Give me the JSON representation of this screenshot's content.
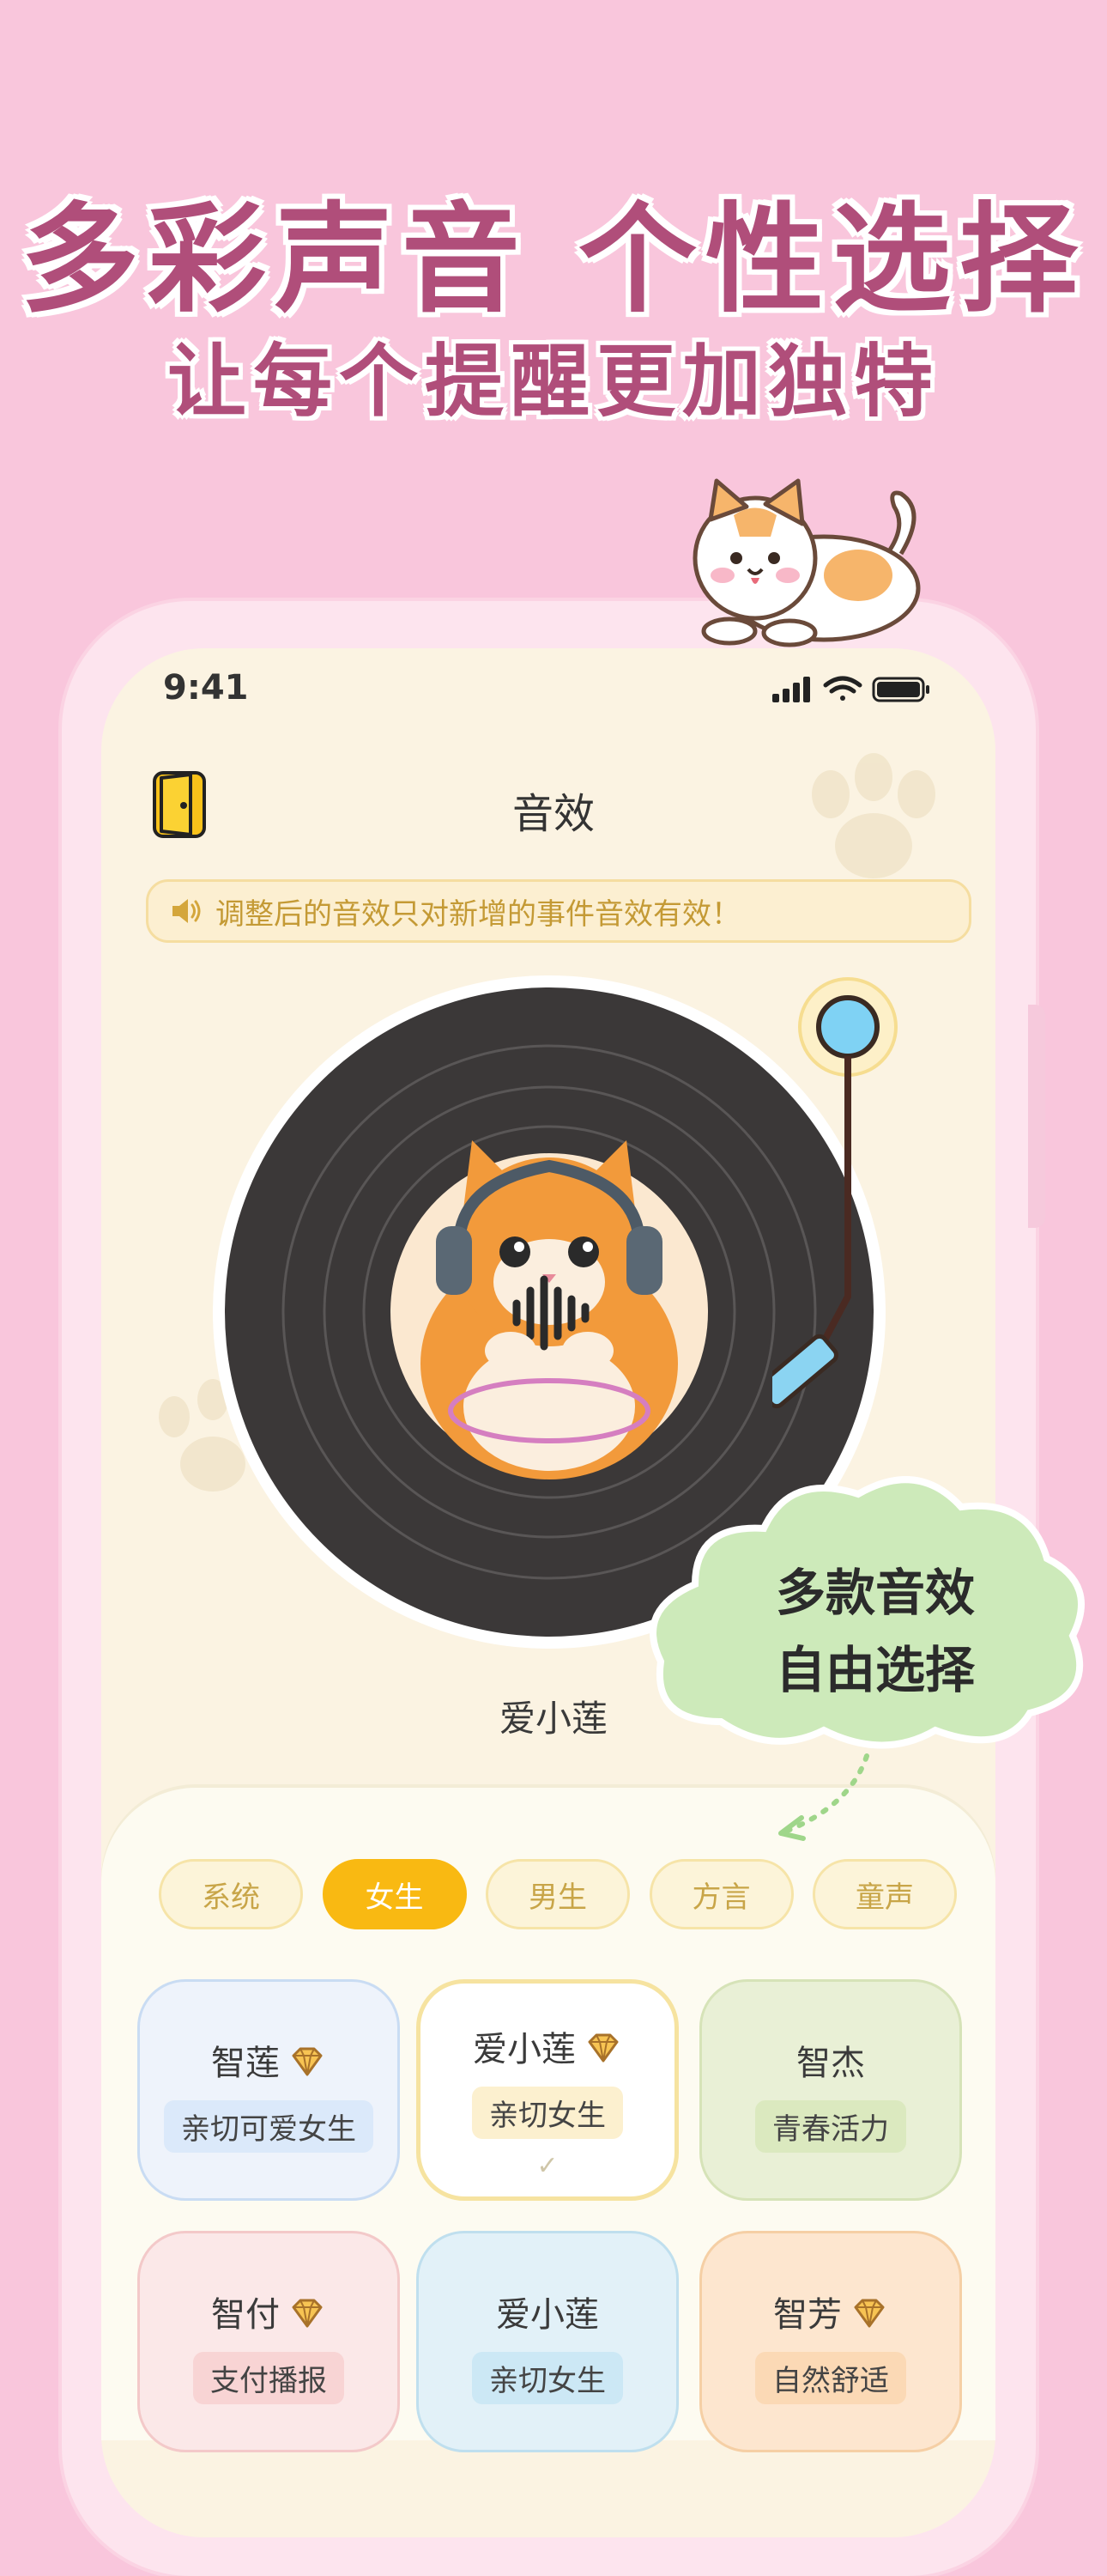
{
  "promo": {
    "headline": "多彩声音 个性选择",
    "subline": "让每个提醒更加独特"
  },
  "status_bar": {
    "time": "9:41"
  },
  "header": {
    "title": "音效"
  },
  "notice": {
    "text": "调整后的音效只对新增的事件音效有效！"
  },
  "player": {
    "current_voice": "爱小莲"
  },
  "callout": {
    "line1": "多款音效",
    "line2": "自由选择"
  },
  "tabs": [
    {
      "label": "系统",
      "active": false
    },
    {
      "label": "女生",
      "active": true
    },
    {
      "label": "男生",
      "active": false
    },
    {
      "label": "方言",
      "active": false
    },
    {
      "label": "童声",
      "active": false
    }
  ],
  "voices": [
    {
      "name": "智莲",
      "tag": "亲切可爱女生",
      "premium": true,
      "selected": false,
      "bg": "#eef3fb",
      "border": "#c9dcf3",
      "tag_bg": "#dbe9fa"
    },
    {
      "name": "爱小莲",
      "tag": "亲切女生",
      "premium": true,
      "selected": true,
      "bg": "#ffffff",
      "border": "#f6e3a0",
      "tag_bg": "#fcf0cf"
    },
    {
      "name": "智杰",
      "tag": "青春活力",
      "premium": false,
      "selected": false,
      "bg": "#e9f0d6",
      "border": "#d6e3b8",
      "tag_bg": "#dbe9bf"
    },
    {
      "name": "智付",
      "tag": "支付播报",
      "premium": true,
      "selected": false,
      "bg": "#fbe8e8",
      "border": "#f3c9c9",
      "tag_bg": "#f8d4d4"
    },
    {
      "name": "爱小莲",
      "tag": "亲切女生",
      "premium": false,
      "selected": false,
      "bg": "#e2f1f8",
      "border": "#bfdfee",
      "tag_bg": "#cce8f5"
    },
    {
      "name": "智芳",
      "tag": "自然舒适",
      "premium": true,
      "selected": false,
      "bg": "#fde6cf",
      "border": "#f5cfa5",
      "tag_bg": "#fbd9b5"
    }
  ],
  "colors": {
    "accent": "#f9b912",
    "brand": "#b04e7a",
    "background": "#f9c6dc"
  }
}
